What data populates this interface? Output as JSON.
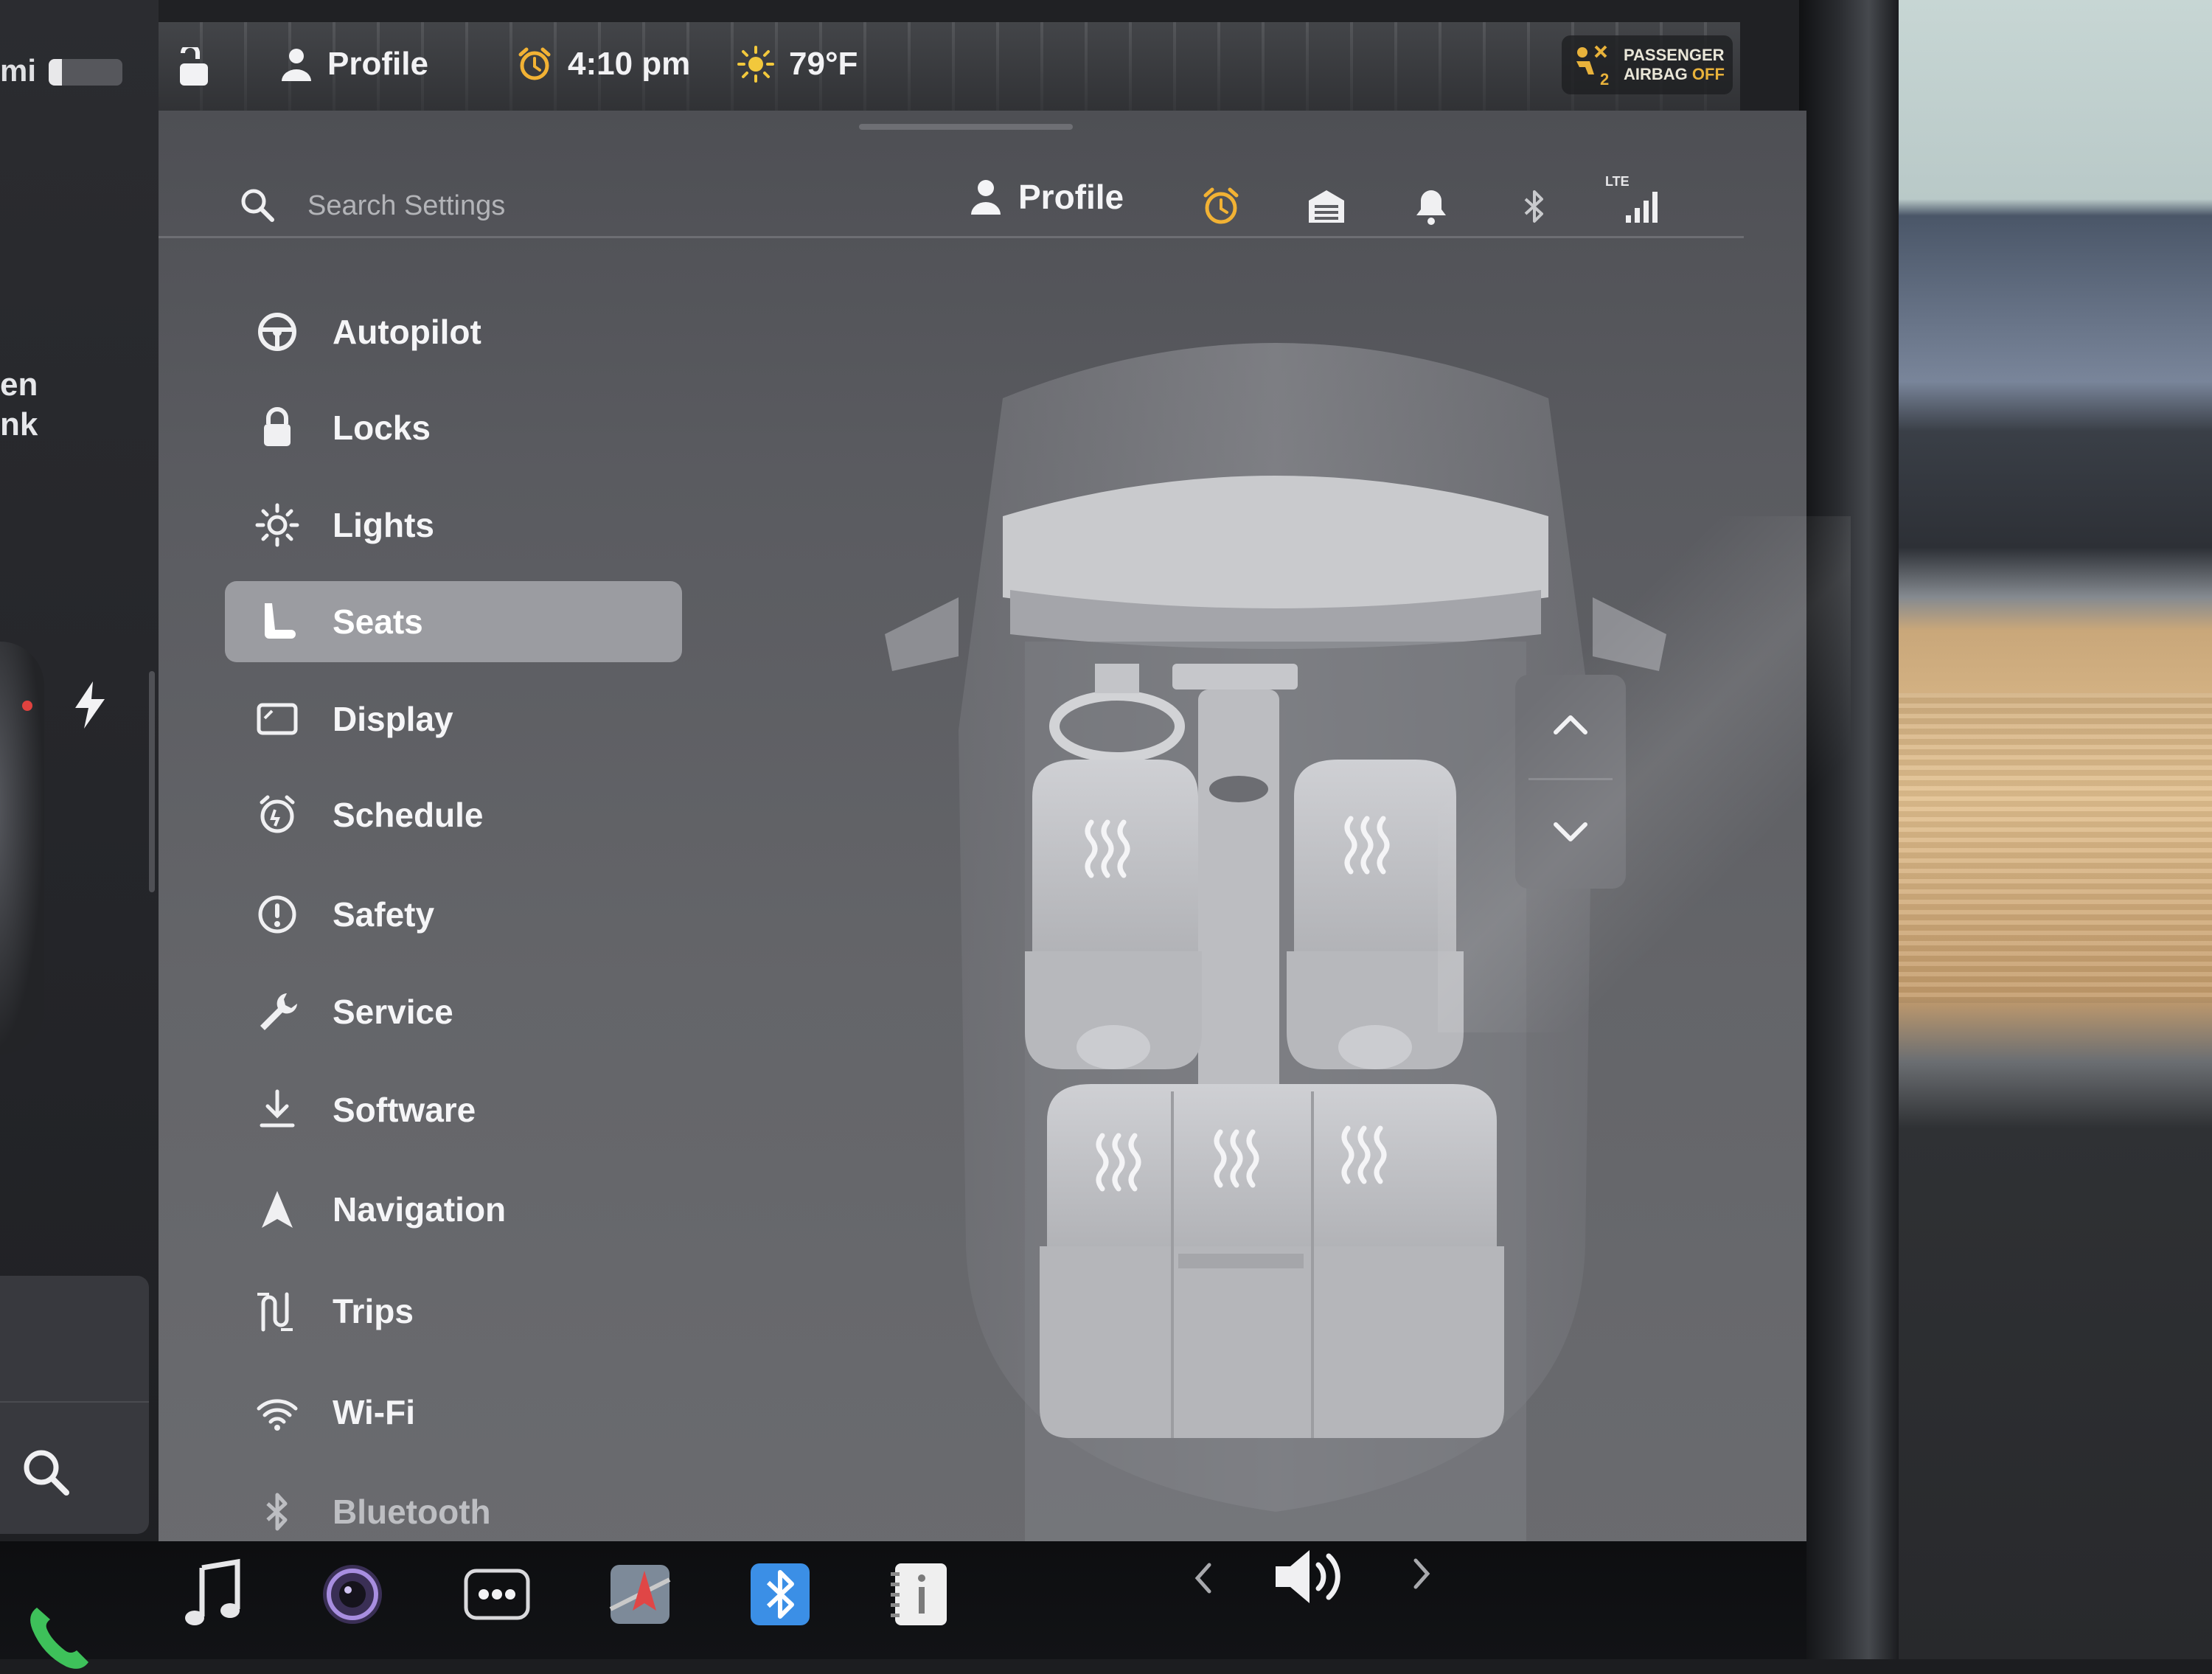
{
  "status_bar": {
    "range_text": "mi",
    "profile_label": "Profile",
    "time": "4:10 pm",
    "temperature": "79°F",
    "airbag_line1": "PASSENGER",
    "airbag_line2_prefix": "AIRBAG",
    "airbag_line2_state": "OFF"
  },
  "car_pane": {
    "trunk_line1": "en",
    "trunk_line2": "nk"
  },
  "settings": {
    "search_placeholder": "Search Settings",
    "profile_label": "Profile",
    "lte_label": "LTE",
    "menu": [
      {
        "label": "Autopilot",
        "icon": "steering-wheel-icon"
      },
      {
        "label": "Locks",
        "icon": "lock-icon"
      },
      {
        "label": "Lights",
        "icon": "sun-icon"
      },
      {
        "label": "Seats",
        "icon": "seat-icon",
        "active": true
      },
      {
        "label": "Display",
        "icon": "display-icon"
      },
      {
        "label": "Schedule",
        "icon": "clock-icon"
      },
      {
        "label": "Safety",
        "icon": "exclamation-icon"
      },
      {
        "label": "Service",
        "icon": "wrench-icon"
      },
      {
        "label": "Software",
        "icon": "download-icon"
      },
      {
        "label": "Navigation",
        "icon": "navigation-arrow-icon"
      },
      {
        "label": "Trips",
        "icon": "trips-icon"
      },
      {
        "label": "Wi-Fi",
        "icon": "wifi-icon"
      },
      {
        "label": "Bluetooth",
        "icon": "bluetooth-icon"
      }
    ]
  },
  "colors": {
    "accent_alarm": "#f2b234",
    "airbag_off": "#e8b23b",
    "active_menu_bg": "#9b9ca1",
    "panel_bg": "#5a5b60"
  }
}
